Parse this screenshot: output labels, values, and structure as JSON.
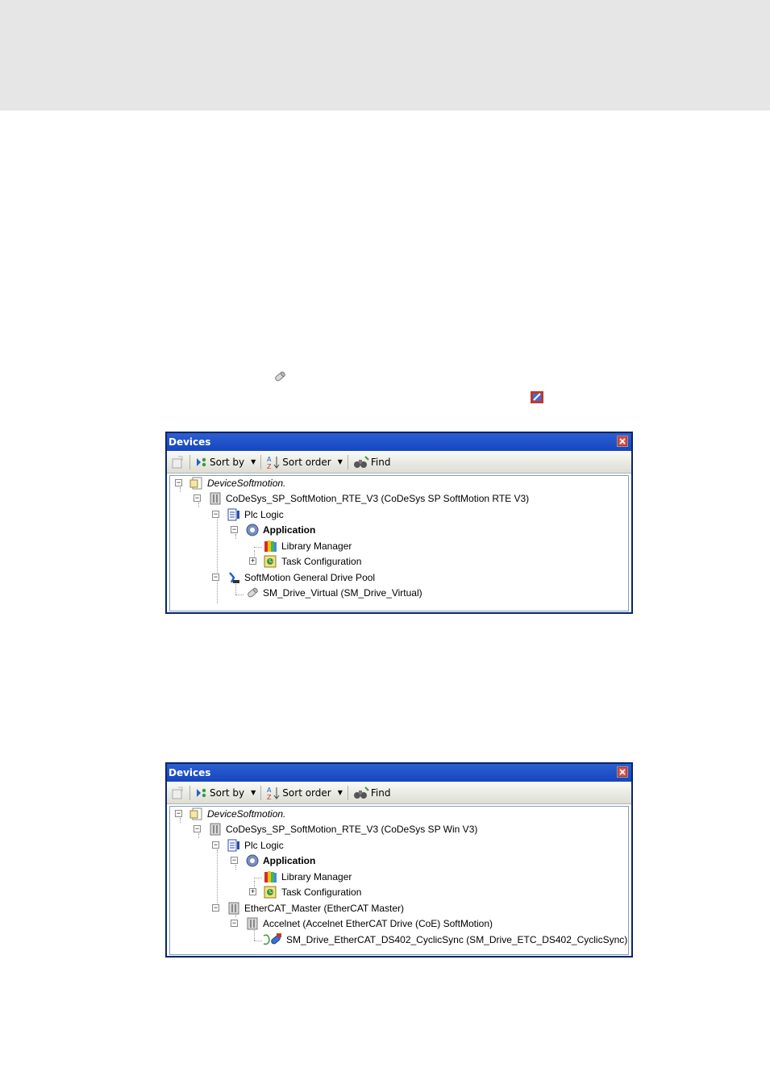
{
  "floating_icons": [
    {
      "name": "drive-cylinder-icon"
    },
    {
      "name": "ethercat-drive-icon"
    }
  ],
  "panels": [
    {
      "title": "Devices",
      "toolbar": {
        "sort_by": "Sort by",
        "sort_order": "Sort order",
        "find": "Find"
      },
      "nodes": [
        {
          "label": "DeviceSoftmotion.",
          "icon": "project-icon",
          "style": "italic"
        },
        {
          "label": "CoDeSys_SP_SoftMotion_RTE_V3 (CoDeSys SP SoftMotion RTE V3)",
          "icon": "device-icon"
        },
        {
          "label": "Plc Logic",
          "icon": "plc-logic-icon"
        },
        {
          "label": "Application",
          "icon": "application-gear-icon",
          "style": "bold"
        },
        {
          "label": "Library Manager",
          "icon": "library-books-icon"
        },
        {
          "label": "Task Configuration",
          "icon": "task-configuration-icon"
        },
        {
          "label": "SoftMotion General Drive Pool",
          "icon": "drive-pool-icon"
        },
        {
          "label": "SM_Drive_Virtual (SM_Drive_Virtual)",
          "icon": "drive-cylinder-icon"
        }
      ]
    },
    {
      "title": "Devices",
      "toolbar": {
        "sort_by": "Sort by",
        "sort_order": "Sort order",
        "find": "Find"
      },
      "nodes": [
        {
          "label": "DeviceSoftmotion.",
          "icon": "project-icon",
          "style": "italic"
        },
        {
          "label": "CoDeSys_SP_SoftMotion_RTE_V3 (CoDeSys SP Win V3)",
          "icon": "device-icon"
        },
        {
          "label": "Plc Logic",
          "icon": "plc-logic-icon"
        },
        {
          "label": "Application",
          "icon": "application-gear-icon",
          "style": "bold"
        },
        {
          "label": "Library Manager",
          "icon": "library-books-icon"
        },
        {
          "label": "Task Configuration",
          "icon": "task-configuration-icon"
        },
        {
          "label": "EtherCAT_Master (EtherCAT Master)",
          "icon": "device-icon"
        },
        {
          "label": "Accelnet (Accelnet EtherCAT Drive (CoE) SoftMotion)",
          "icon": "device-icon"
        },
        {
          "label": "SM_Drive_EtherCAT_DS402_CyclicSync (SM_Drive_ETC_DS402_CyclicSync)",
          "icon": "ethercat-drive-icon"
        }
      ]
    }
  ]
}
